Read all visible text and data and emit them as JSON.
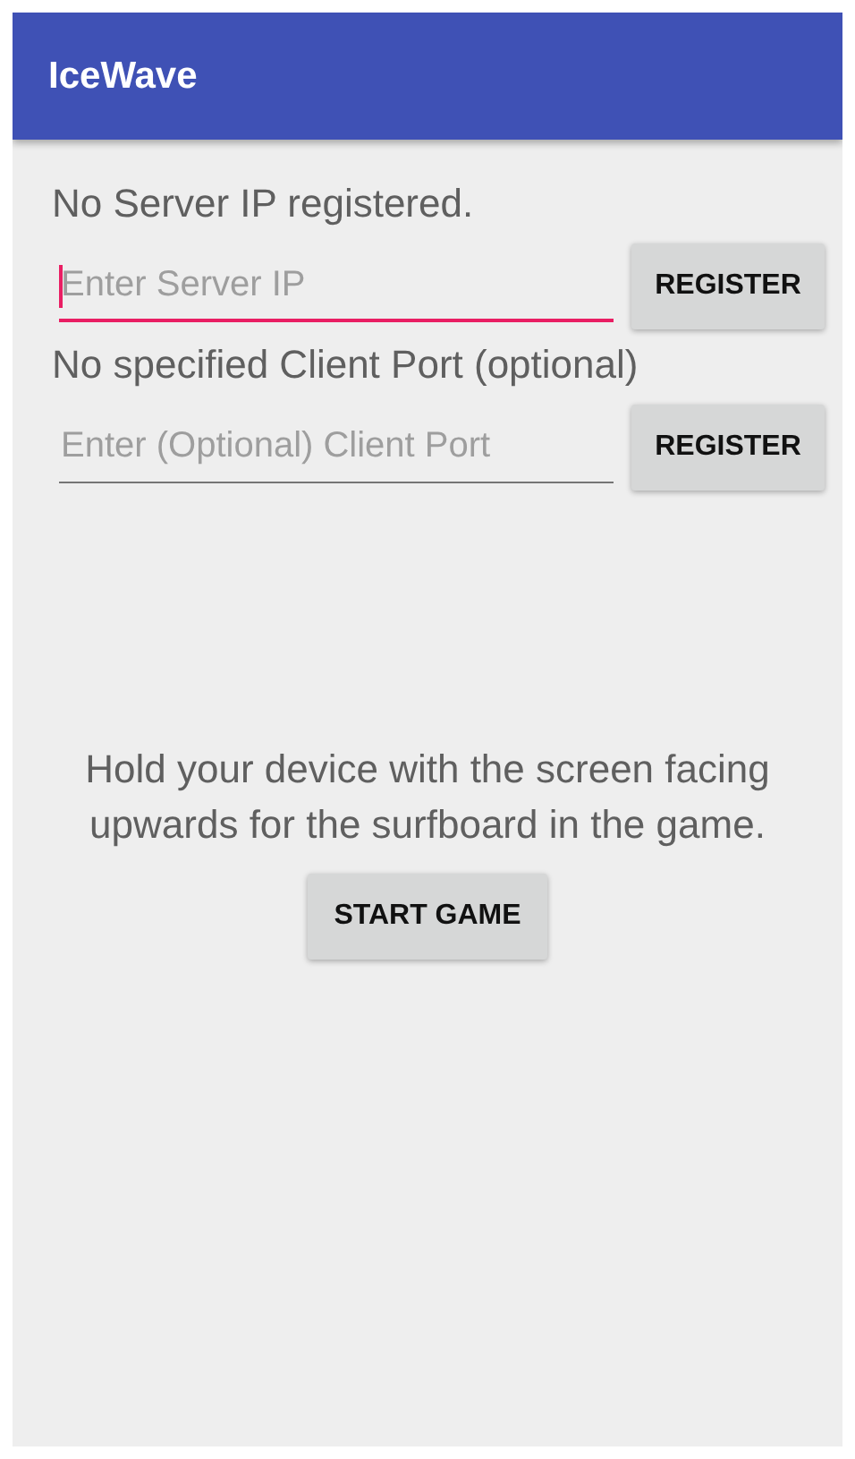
{
  "app_bar": {
    "title": "IceWave"
  },
  "server": {
    "status": "No Server IP registered.",
    "field": {
      "placeholder": "Enter Server IP",
      "focused": true
    },
    "button": "REGISTER"
  },
  "client": {
    "status": "No specified Client Port (optional)",
    "field": {
      "placeholder": "Enter (Optional) Client Port",
      "focused": false
    },
    "button": "REGISTER"
  },
  "instructions": "Hold your device with the screen facing upwards for the surfboard in the game.",
  "start_button": "START GAME"
}
